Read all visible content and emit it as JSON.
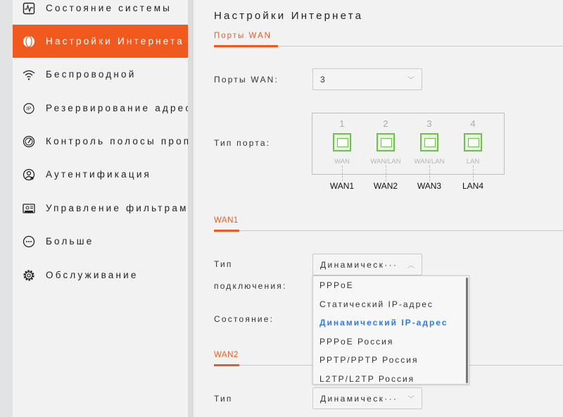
{
  "sidebar": {
    "items": [
      {
        "label": "Состояние системы",
        "icon": "activity-monitor-icon"
      },
      {
        "label": "Настройки Интернета",
        "icon": "globe-icon",
        "active": true
      },
      {
        "label": "Беспроводной",
        "icon": "wifi-icon"
      },
      {
        "label": "Резервирование адресов",
        "icon": "ip-icon"
      },
      {
        "label": "Контроль полосы пропускания",
        "icon": "speedometer-icon"
      },
      {
        "label": "Аутентификация",
        "icon": "user-auth-icon"
      },
      {
        "label": "Управление фильтрами",
        "icon": "filter-card-icon"
      },
      {
        "label": "Больше",
        "icon": "more-icon"
      },
      {
        "label": "Обслуживание",
        "icon": "gear-icon"
      }
    ]
  },
  "main": {
    "title": "Настройки Интернета",
    "wan_ports_section": "Порты WAN",
    "wan_ports_label": "Порты WAN:",
    "wan_ports_value": "3",
    "port_type_label": "Тип порта:",
    "ports": [
      {
        "num": "1",
        "type": "WAN",
        "name": "WAN1"
      },
      {
        "num": "2",
        "type": "WAN/LAN",
        "name": "WAN2"
      },
      {
        "num": "3",
        "type": "WAN/LAN",
        "name": "WAN3"
      },
      {
        "num": "4",
        "type": "LAN",
        "name": "LAN4"
      }
    ],
    "wan1": {
      "section": "WAN1",
      "conn_type_label_1": "Тип",
      "conn_type_label_2": "подключения:",
      "conn_type_value": "Динамическ···",
      "status_label": "Состояние:"
    },
    "dropdown_options": [
      "PPPoE",
      "Статический IP-адрес",
      "Динамический IP-адрес",
      "PPPoE Россия",
      "PPTP/PPTP Россия",
      "L2TP/L2TP Россия"
    ],
    "dropdown_selected": "Динамический IP-адрес",
    "wan2": {
      "section": "WAN2",
      "conn_type_label_1": "Тип",
      "conn_type_value": "Динамическ···"
    }
  },
  "colors": {
    "accent": "#f05a1e",
    "selected_option": "#2f7be0",
    "port_green": "#6cc24a"
  }
}
